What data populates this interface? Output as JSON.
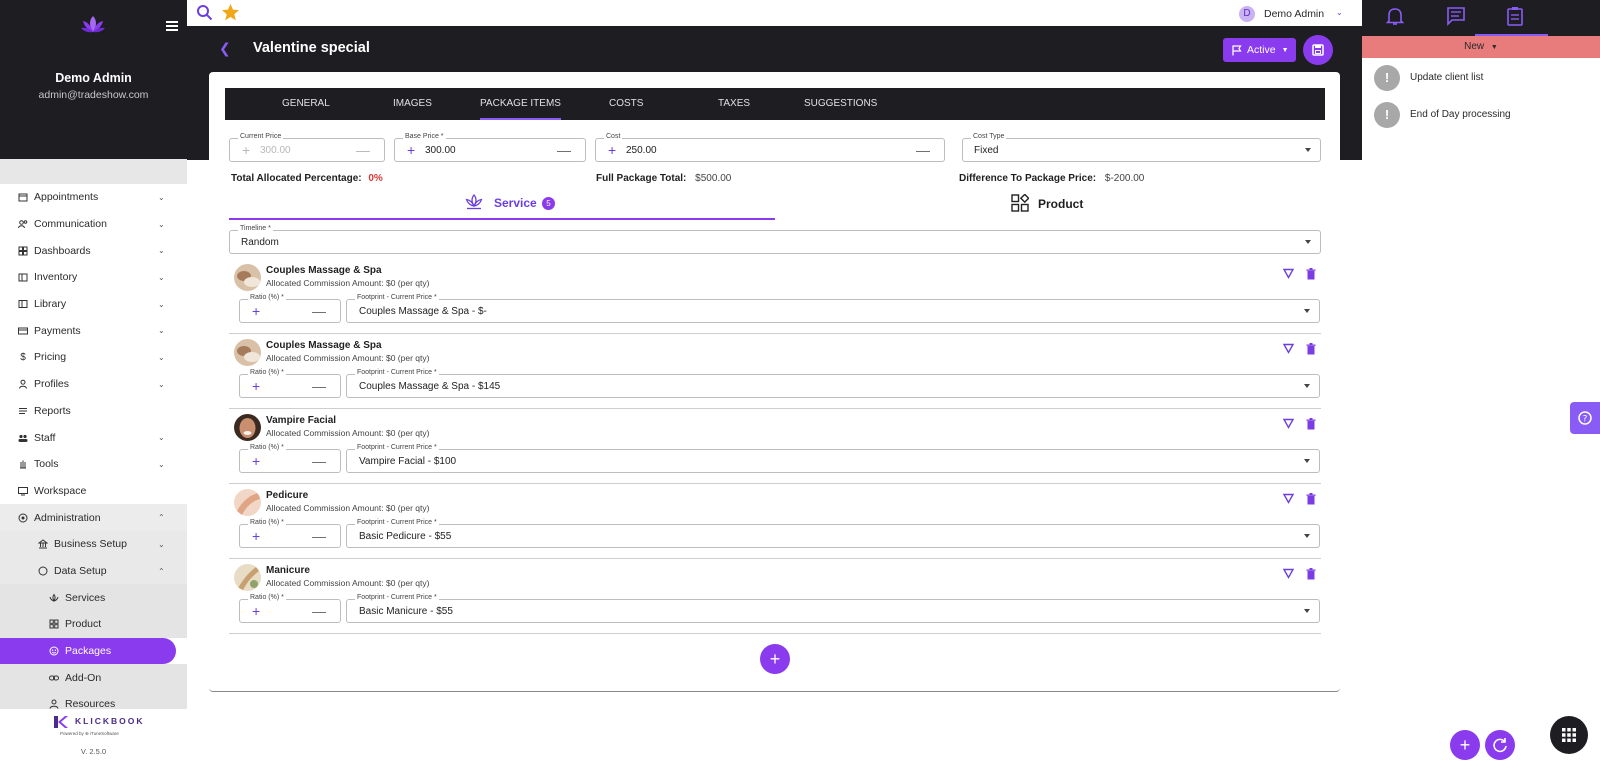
{
  "sidebar": {
    "user_name": "Demo Admin",
    "user_email": "admin@tradeshow.com",
    "nav": [
      {
        "label": "Appointments",
        "icon": "calendar-icon"
      },
      {
        "label": "Communication",
        "icon": "people-icon"
      },
      {
        "label": "Dashboards",
        "icon": "dashboard-icon"
      },
      {
        "label": "Inventory",
        "icon": "inventory-icon"
      },
      {
        "label": "Library",
        "icon": "library-icon"
      },
      {
        "label": "Payments",
        "icon": "card-icon"
      },
      {
        "label": "Pricing",
        "icon": "dollar-icon"
      },
      {
        "label": "Profiles",
        "icon": "person-icon"
      },
      {
        "label": "Reports",
        "icon": "reports-icon"
      },
      {
        "label": "Staff",
        "icon": "staff-icon"
      },
      {
        "label": "Tools",
        "icon": "hand-icon"
      },
      {
        "label": "Workspace",
        "icon": "workspace-icon"
      },
      {
        "label": "Administration",
        "icon": "target-icon"
      },
      {
        "label": "Business Setup",
        "icon": "building-icon"
      },
      {
        "label": "Data Setup",
        "icon": "circle-icon"
      },
      {
        "label": "Services",
        "icon": "lotus-icon"
      },
      {
        "label": "Product",
        "icon": "grid-icon"
      },
      {
        "label": "Packages",
        "icon": "package-icon"
      },
      {
        "label": "Add-On",
        "icon": "link-icon"
      },
      {
        "label": "Resources",
        "icon": "resource-icon"
      }
    ],
    "brand": "KLICKBOOK",
    "brand_sub": "Powered by ⊕ iTuneSoftware",
    "version": "V. 2.5.0"
  },
  "topbar": {
    "user_initial": "D",
    "user_name": "Demo Admin"
  },
  "header": {
    "title": "Valentine special",
    "status_label": "Active"
  },
  "tabs": [
    "GENERAL",
    "IMAGES",
    "PACKAGE ITEMS",
    "COSTS",
    "TAXES",
    "SUGGESTIONS"
  ],
  "pricing": {
    "current_price_label": "Current Price",
    "current_price": "300.00",
    "base_price_label": "Base Price *",
    "base_price": "300.00",
    "cost_label": "Cost",
    "cost": "250.00",
    "cost_type_label": "Cost Type",
    "cost_type": "Fixed"
  },
  "summary": {
    "allocated_label": "Total Allocated Percentage:",
    "allocated_value": "0%",
    "full_total_label": "Full Package Total:",
    "full_total_value": "$500.00",
    "difference_label": "Difference To Package Price:",
    "difference_value": "$-200.00"
  },
  "section_tabs": {
    "service_label": "Service",
    "service_count": "5",
    "product_label": "Product"
  },
  "timeline": {
    "label": "Timeline *",
    "value": "Random"
  },
  "items": [
    {
      "name": "Couples Massage & Spa",
      "commission": "Allocated Commission Amount: $0 (per qty)",
      "ratio_label": "Ratio (%) *",
      "footprint_label": "Footprint - Current Price *",
      "footprint": "Couples Massage & Spa - $-"
    },
    {
      "name": "Couples Massage & Spa",
      "commission": "Allocated Commission Amount: $0 (per qty)",
      "ratio_label": "Ratio (%) *",
      "footprint_label": "Footprint - Current Price *",
      "footprint": "Couples Massage & Spa - $145"
    },
    {
      "name": "Vampire Facial",
      "commission": "Allocated Commission Amount: $0 (per qty)",
      "ratio_label": "Ratio (%) *",
      "footprint_label": "Footprint - Current Price *",
      "footprint": "Vampire Facial - $100"
    },
    {
      "name": "Pedicure",
      "commission": "Allocated Commission Amount: $0 (per qty)",
      "ratio_label": "Ratio (%) *",
      "footprint_label": "Footprint - Current Price *",
      "footprint": "Basic Pedicure - $55"
    },
    {
      "name": "Manicure",
      "commission": "Allocated Commission Amount: $0 (per qty)",
      "ratio_label": "Ratio (%) *",
      "footprint_label": "Footprint - Current Price *",
      "footprint": "Basic Manicure - $55"
    }
  ],
  "right_panel": {
    "filter_label": "New",
    "tasks": [
      "Update client list",
      "End of Day processing"
    ]
  },
  "colors": {
    "accent": "#8a3bed",
    "dark": "#1d1d22",
    "alert_bar": "#e87b7b",
    "negative": "#d63a3a"
  }
}
